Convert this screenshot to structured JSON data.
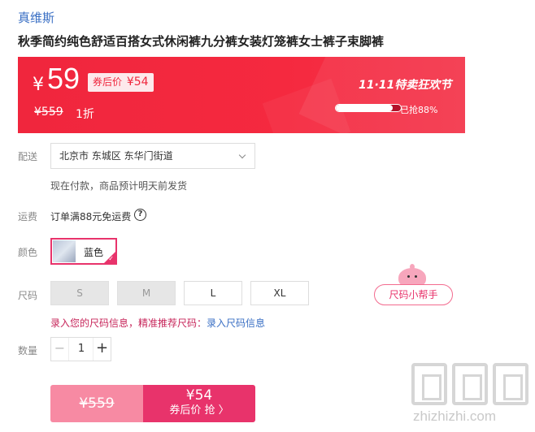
{
  "brand": "真维斯",
  "product_title": "秋季简约纯色舒适百搭女式休闲裤九分裤女装灯笼裤女士裤子束脚裤",
  "price": {
    "currency": "¥",
    "current": "59",
    "coupon_label": "券后价",
    "coupon_price": "¥54",
    "original": "¥559",
    "discount": "1折",
    "festival": "11·11特卖狂欢节",
    "sold_progress": 88,
    "sold_text": "已抢88%"
  },
  "shipping": {
    "label": "配送",
    "location": "北京市 东城区 东华门街道",
    "note": "现在付款，商品预计明天前发货"
  },
  "freight": {
    "label": "运费",
    "text": "订单满88元免运费",
    "help_glyph": "?"
  },
  "color": {
    "label": "颜色",
    "selected": "蓝色",
    "check_glyph": "✓"
  },
  "size": {
    "label": "尺码",
    "options": [
      {
        "label": "S",
        "available": false
      },
      {
        "label": "M",
        "available": false
      },
      {
        "label": "L",
        "available": true
      },
      {
        "label": "XL",
        "available": true
      }
    ],
    "helper_button": "尺码小帮手",
    "tip_text": "录入您的尺码信息，精准推荐尺码：",
    "tip_link": "录入尺码信息"
  },
  "quantity": {
    "label": "数量",
    "value": "1",
    "minus": "−",
    "plus": "+"
  },
  "buy": {
    "original": "¥559",
    "coupon_price": "¥54",
    "action_label": "券后价 抢 〉"
  },
  "watermark": "zhizhizhi.com",
  "colors": {
    "accent": "#f0263d",
    "pink": "#e8336b",
    "link": "#3a6fc4"
  }
}
